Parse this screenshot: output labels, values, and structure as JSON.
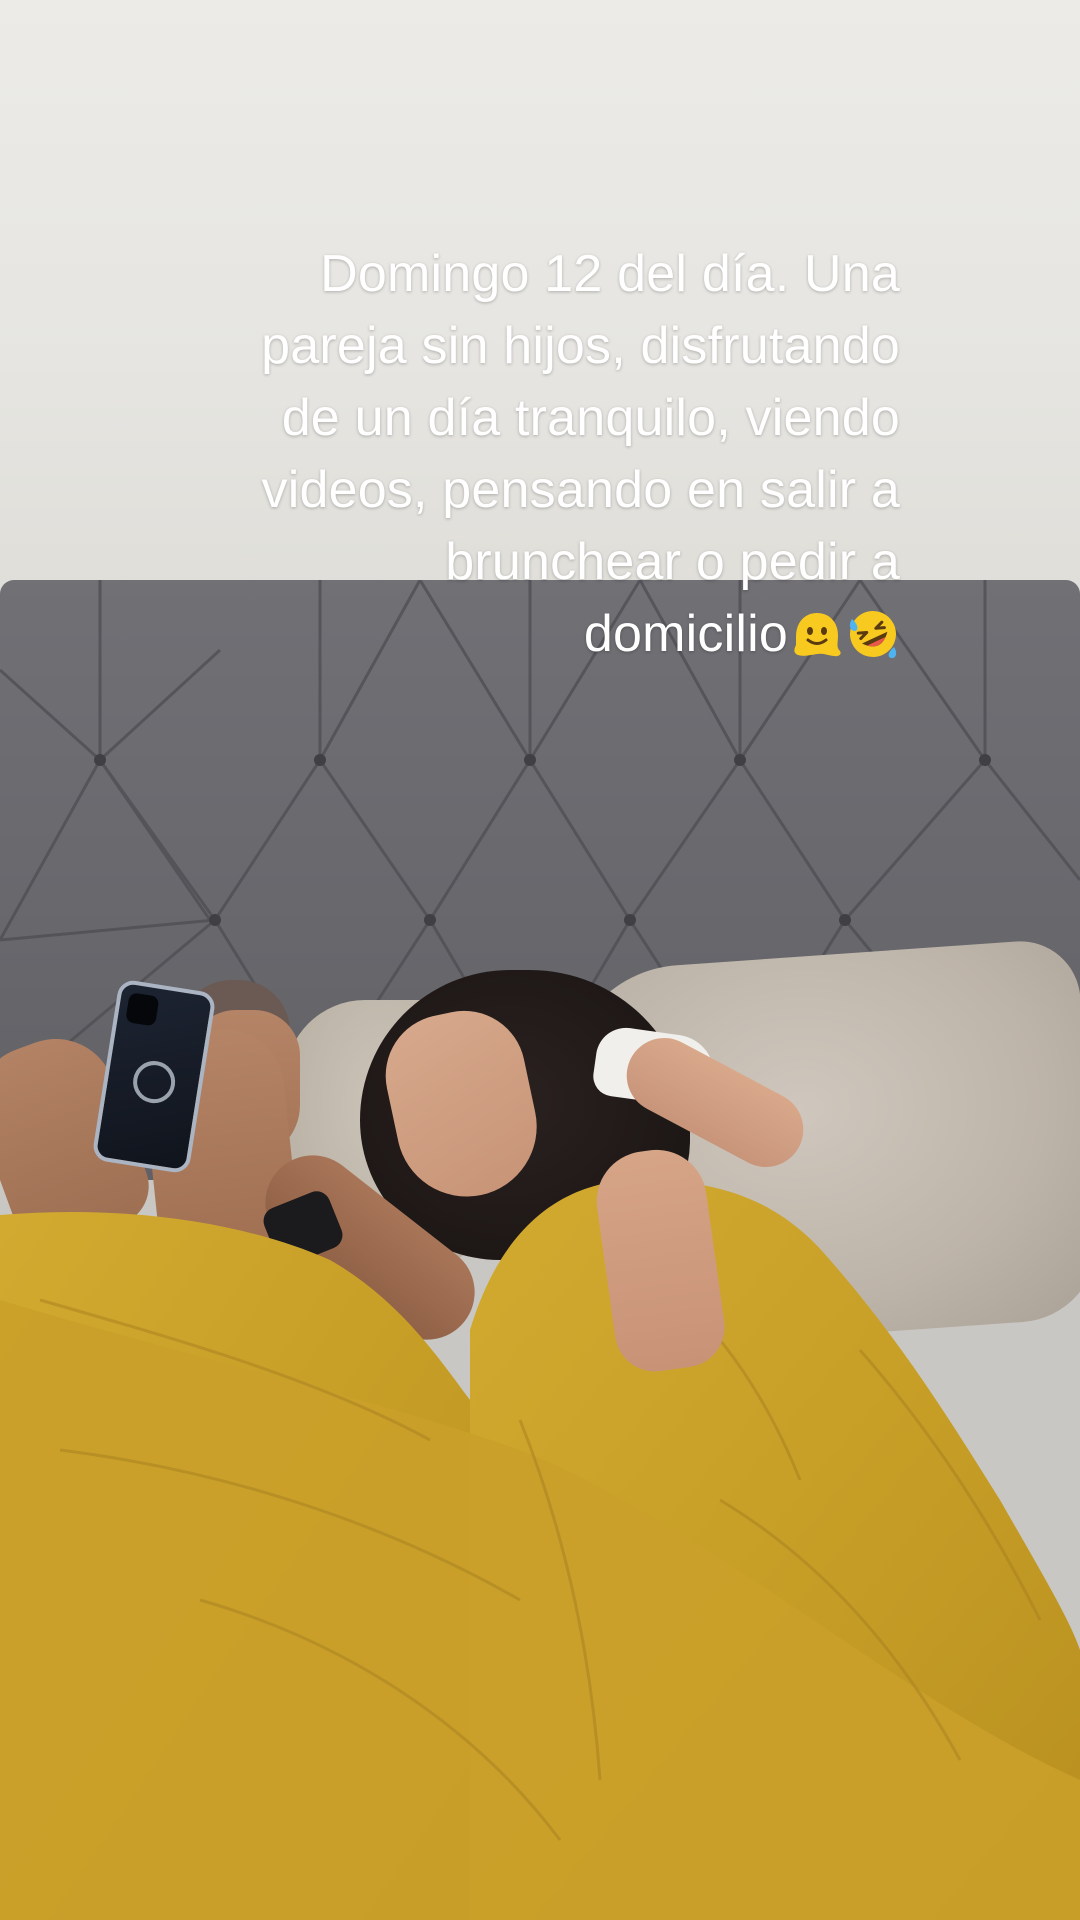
{
  "video": {
    "caption_lines": [
      "Domingo 12 del día. Una",
      "pareja sin hijos, disfrutando",
      "de un día tranquilo, viendo",
      "videos, pensando en salir a",
      "brunchear o pedir a",
      "domicilio"
    ],
    "caption_emojis": [
      "melting-face-emoji",
      "rolling-on-the-floor-laughing-emoji"
    ]
  },
  "colors": {
    "caption_text": "#ffffff",
    "duvet": "#c9a22a",
    "headboard": "#67676c",
    "wall": "#e8e7e3"
  }
}
